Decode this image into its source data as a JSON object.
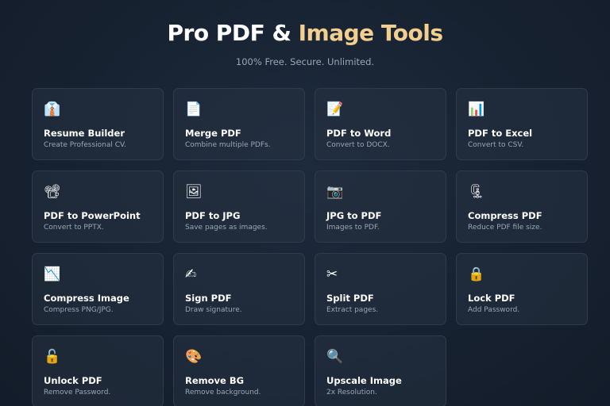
{
  "header": {
    "title_main": "Pro PDF & ",
    "title_accent": "Image Tools",
    "subtitle": "100% Free. Secure. Unlimited."
  },
  "colors": {
    "accent": "#f2cf8e",
    "background": "#172231",
    "card_background": "#222e3d",
    "card_border": "#2f3b4b",
    "muted_text": "#9aa6b6"
  },
  "tools": [
    {
      "icon": "👔",
      "icon_name": "necktie-icon",
      "title": "Resume Builder",
      "desc": "Create Professional CV."
    },
    {
      "icon": "📄",
      "icon_name": "document-icon",
      "title": "Merge PDF",
      "desc": "Combine multiple PDFs."
    },
    {
      "icon": "📝",
      "icon_name": "memo-icon",
      "title": "PDF to Word",
      "desc": "Convert to DOCX."
    },
    {
      "icon": "📊",
      "icon_name": "bar-chart-icon",
      "title": "PDF to Excel",
      "desc": "Convert to CSV."
    },
    {
      "icon": "📽",
      "icon_name": "film-projector-icon",
      "title": "PDF to PowerPoint",
      "desc": "Convert to PPTX."
    },
    {
      "icon": "🖼",
      "icon_name": "framed-picture-icon",
      "title": "PDF to JPG",
      "desc": "Save pages as images."
    },
    {
      "icon": "📷",
      "icon_name": "camera-icon",
      "title": "JPG to PDF",
      "desc": "Images to PDF."
    },
    {
      "icon": "🗜",
      "icon_name": "clamp-icon",
      "title": "Compress PDF",
      "desc": "Reduce PDF file size."
    },
    {
      "icon": "📉",
      "icon_name": "chart-decreasing-icon",
      "title": "Compress Image",
      "desc": "Compress PNG/JPG."
    },
    {
      "icon": "✍",
      "icon_name": "writing-hand-icon",
      "title": "Sign PDF",
      "desc": "Draw signature."
    },
    {
      "icon": "✂",
      "icon_name": "scissors-icon",
      "title": "Split PDF",
      "desc": "Extract pages."
    },
    {
      "icon": "🔒",
      "icon_name": "lock-icon",
      "title": "Lock PDF",
      "desc": "Add Password."
    },
    {
      "icon": "🔓",
      "icon_name": "unlock-icon",
      "title": "Unlock PDF",
      "desc": "Remove Password."
    },
    {
      "icon": "🎨",
      "icon_name": "palette-icon",
      "title": "Remove BG",
      "desc": "Remove background."
    },
    {
      "icon": "🔍",
      "icon_name": "magnifier-icon",
      "title": "Upscale Image",
      "desc": "2x Resolution."
    }
  ]
}
